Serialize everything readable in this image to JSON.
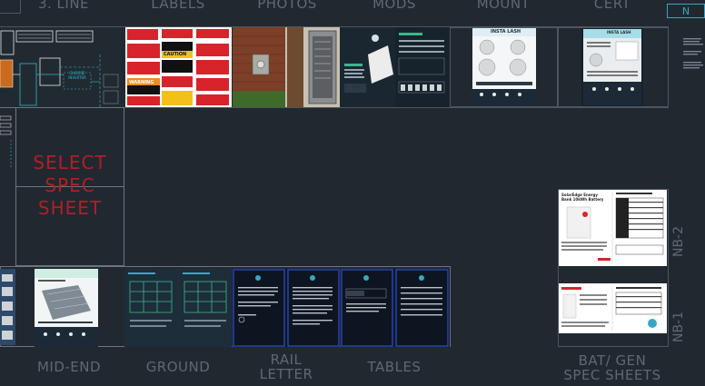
{
  "top_labels": [
    "3. LINE",
    "LABELS",
    "PHOTOS",
    "MODS",
    "MOUNT",
    "CERT"
  ],
  "corner_tag": "N",
  "placeholder": {
    "line1": "SELECT",
    "line2": "SPEC",
    "line3": "SHEET"
  },
  "bottom_labels": {
    "mid_end": "MID-END",
    "ground": "GROUND",
    "rail_letter_line1": "RAIL",
    "rail_letter_line2": "LETTER",
    "tables": "TABLES",
    "bat_gen_line1": "BAT/ GEN",
    "bat_gen_line2": "SPEC SHEETS"
  },
  "side_labels": {
    "nb2": "NB-2",
    "nb1": "NB-1"
  },
  "thumb_titles": {
    "inverter": "CHOOSE INVERTER",
    "warning": "WARNING",
    "caution": "CAUTION",
    "mount_brand": "INSTA LASH",
    "cert_brand": "INSTA LASH",
    "bat_title": "SolarEdge Energy Bank 10kWh Battery"
  },
  "colors": {
    "background": "#212830",
    "label": "#5f6873",
    "frame": "#6c757f",
    "placeholder_text": "#b21e26",
    "accent": "#3aa6c4"
  }
}
